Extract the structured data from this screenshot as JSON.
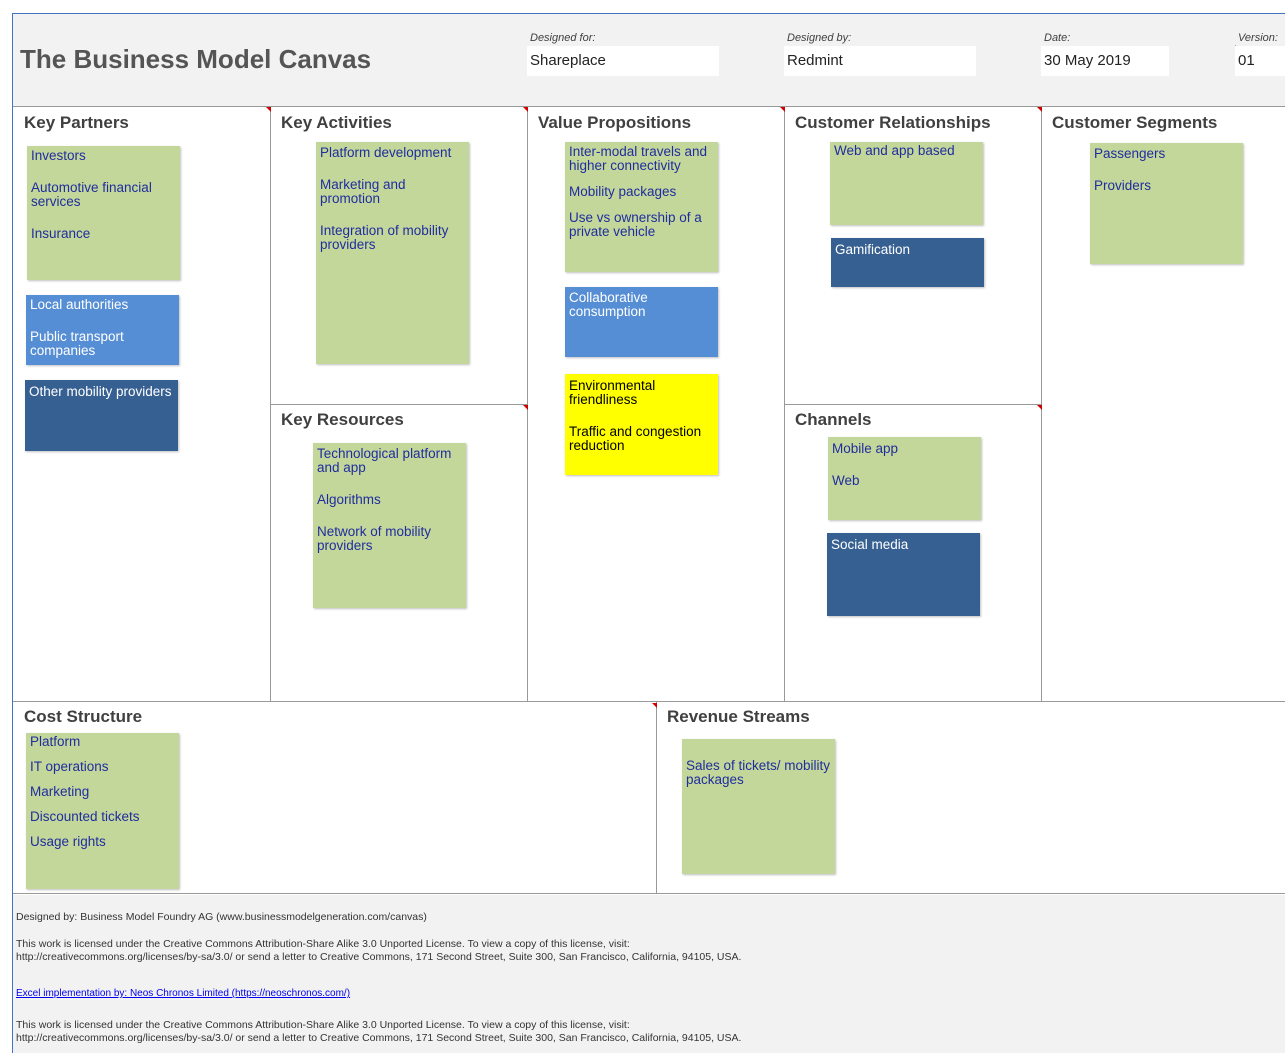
{
  "header": {
    "title": "The Business Model Canvas",
    "designed_for_label": "Designed for:",
    "designed_for_value": "Shareplace",
    "designed_by_label": "Designed by:",
    "designed_by_value": "Redmint",
    "date_label": "Date:",
    "date_value": "30 May 2019",
    "version_label": "Version:",
    "version_value": "01"
  },
  "sections": {
    "key_partners": "Key Partners",
    "key_activities": "Key Activities",
    "key_resources": "Key Resources",
    "value_propositions": "Value Propositions",
    "customer_relationships": "Customer Relationships",
    "channels": "Channels",
    "customer_segments": "Customer Segments",
    "cost_structure": "Cost Structure",
    "revenue_streams": "Revenue Streams"
  },
  "notes": {
    "kp1": [
      "Investors",
      "Automotive financial services",
      "Insurance"
    ],
    "kp2": [
      "Local authorities",
      "Public transport companies"
    ],
    "kp3": [
      "Other mobility providers"
    ],
    "ka1": [
      "Platform development",
      "Marketing and promotion",
      "Integration of mobility providers"
    ],
    "kr1": [
      "Technological platform and app",
      "Algorithms",
      "Network of mobility providers"
    ],
    "vp1": [
      "Inter-modal travels and higher connectivity",
      "Mobility packages",
      "Use vs ownership of a private vehicle"
    ],
    "vp2": [
      "Collaborative consumption"
    ],
    "vp3": [
      "Environmental friendliness",
      "Traffic and congestion reduction"
    ],
    "cr1": [
      "Web and app based"
    ],
    "cr2": [
      "Gamification"
    ],
    "ch1": [
      "Mobile app",
      "Web"
    ],
    "ch2": [
      "Social media"
    ],
    "cs1": [
      "Passengers",
      "Providers"
    ],
    "cost1": [
      "Platform",
      "IT operations",
      "Marketing",
      "Discounted tickets",
      "Usage rights"
    ],
    "rev1": [
      "Sales of tickets/ mobility packages"
    ]
  },
  "colors": {
    "note_green": "#c4d79b",
    "note_blue": "#558ed5",
    "note_dark": "#366092",
    "note_yellow": "#ffff00",
    "note_text": "#1f2d9e",
    "frame_border": "#4472c4"
  },
  "footer": {
    "line1": "Designed by: Business Model Foundry AG (www.businessmodelgeneration.com/canvas)",
    "line2a": "This work is licensed under the Creative Commons Attribution-Share Alike 3.0 Unported License. To view a copy of this license, visit:",
    "line2b": "http://creativecommons.org/licenses/by-sa/3.0/ or send a letter to Creative Commons, 171 Second Street, Suite 300, San Francisco, California, 94105, USA.",
    "link": "Excel implementation by: Neos Chronos Limited (https://neoschronos.com/)",
    "line3a": "This work is licensed under the Creative Commons Attribution-Share Alike 3.0 Unported License. To view a copy of this license, visit:",
    "line3b": "http://creativecommons.org/licenses/by-sa/3.0/ or send a letter to Creative Commons, 171 Second Street, Suite 300, San Francisco, California, 94105, USA."
  }
}
